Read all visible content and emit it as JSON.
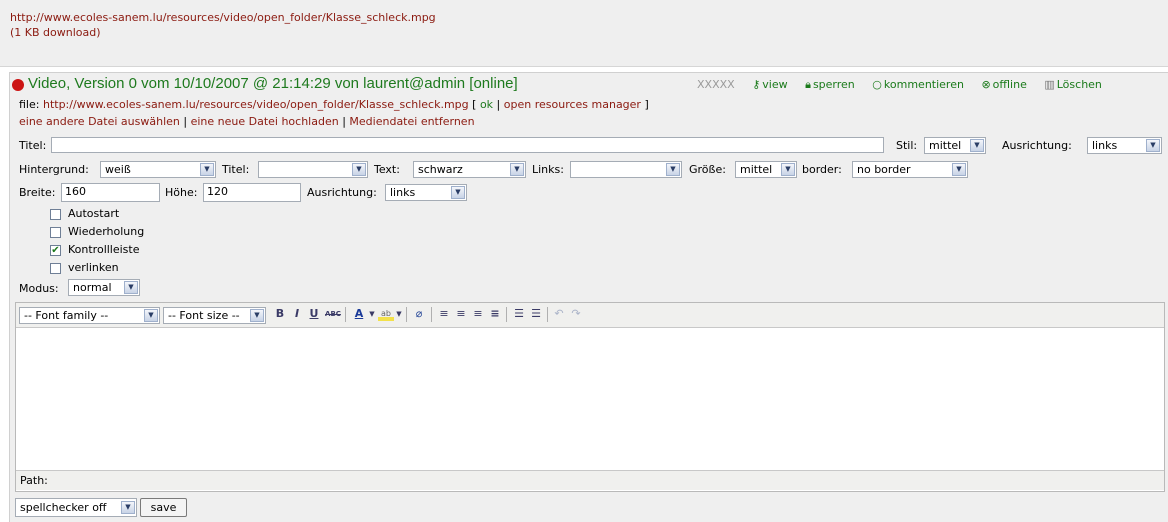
{
  "download": {
    "url": "http://www.ecoles-sanem.lu/resources/video/open_folder/Klasse_schleck.mpg",
    "size": "(1 KB download)"
  },
  "header": {
    "title": "Video, Version 0 vom 10/10/2007 @ 21:14:29 von laurent@admin [online]",
    "placeholder_x": "XXXXX",
    "actions": {
      "view": "view",
      "lock": "sperren",
      "comment": "kommentieren",
      "offline": "offline",
      "delete": "Löschen"
    },
    "file_label": "file:",
    "file_url": "http://www.ecoles-sanem.lu/resources/video/open_folder/Klasse_schleck.mpg",
    "bracket_open": "[",
    "ok": "ok",
    "pipe": "|",
    "resources_manager": "open resources manager",
    "bracket_close": "]",
    "links": {
      "choose_other": "eine andere Datei auswählen",
      "upload_new": "eine neue Datei hochladen",
      "remove": "Mediendatei entfernen"
    }
  },
  "form": {
    "titel_label": "Titel:",
    "titel_value": "",
    "stil_label": "Stil:",
    "stil_value": "mittel",
    "ausrichtung_label": "Ausrichtung:",
    "ausrichtung_value": "links",
    "hintergrund_label": "Hintergrund:",
    "hintergrund_value": "weiß",
    "titel2_label": "Titel:",
    "titel2_value": "",
    "text_label": "Text:",
    "text_value": "schwarz",
    "links_label": "Links:",
    "links_value": "",
    "groesse_label": "Größe:",
    "groesse_value": "mittel",
    "border_label": "border:",
    "border_value": "no border",
    "breite_label": "Breite:",
    "breite_value": "160",
    "hoehe_label": "Höhe:",
    "hoehe_value": "120",
    "ausrichtung2_label": "Ausrichtung:",
    "ausrichtung2_value": "links",
    "checkboxes": [
      {
        "label": "Autostart",
        "checked": false
      },
      {
        "label": "Wiederholung",
        "checked": false
      },
      {
        "label": "Kontrollleiste",
        "checked": true
      },
      {
        "label": "verlinken",
        "checked": false
      }
    ],
    "modus_label": "Modus:",
    "modus_value": "normal"
  },
  "editor": {
    "font_family": "-- Font family --",
    "font_size": "-- Font size --",
    "bold": "B",
    "italic": "I",
    "underline": "U",
    "strike": "ABC",
    "text_color": "A",
    "bg_color": "ab",
    "path_label": "Path:"
  },
  "footer": {
    "spellchecker": "spellchecker off",
    "save": "save"
  },
  "colors": {
    "link": "#8b1a10",
    "accent_green": "#1e7a1e",
    "status_dot": "#cc1414"
  }
}
